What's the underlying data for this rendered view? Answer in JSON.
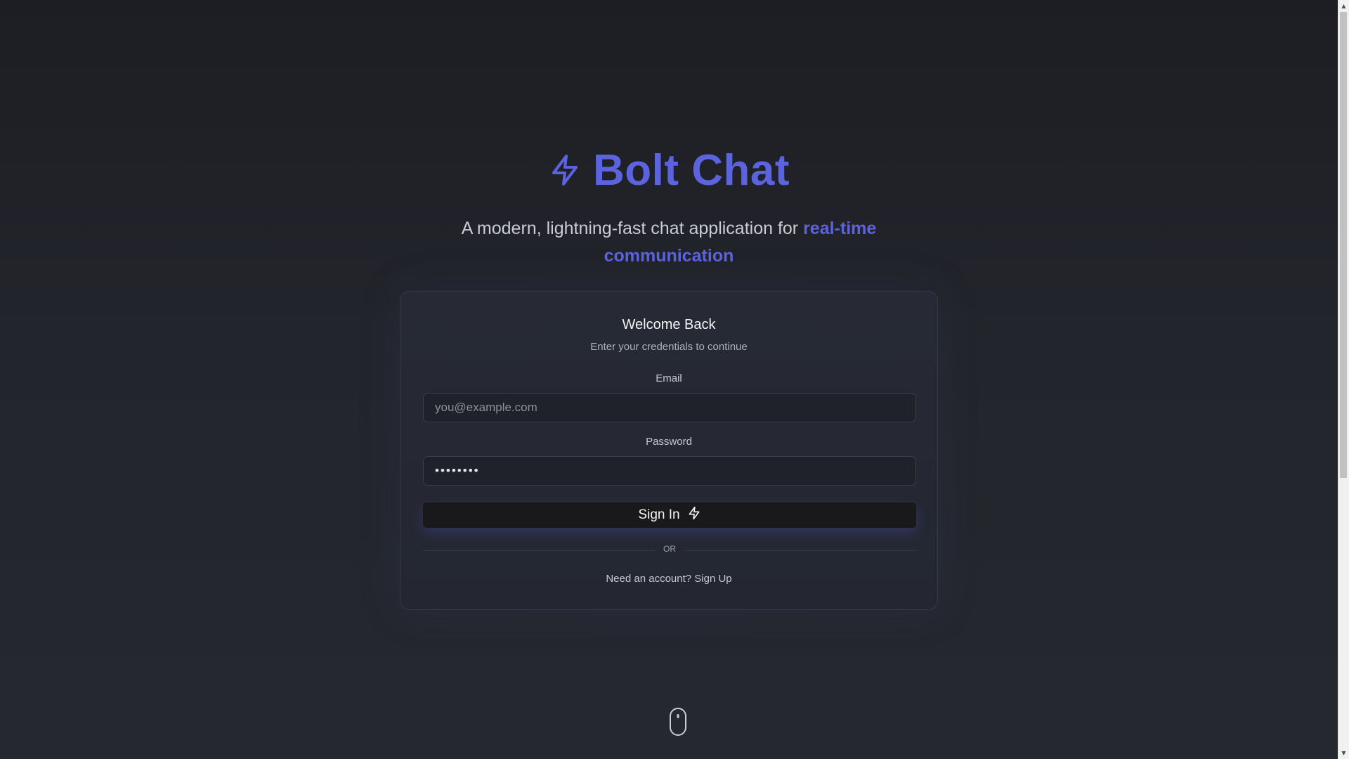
{
  "brand": {
    "title": "Bolt Chat",
    "icon": "lightning-bolt-icon",
    "color": "#5b63de"
  },
  "hero": {
    "tagline_prefix": "A modern, lightning-fast chat application for ",
    "tagline_accent": "real-time communication"
  },
  "login": {
    "title": "Welcome Back",
    "subtitle": "Enter your credentials to continue",
    "email_label": "Email",
    "email_placeholder": "you@example.com",
    "email_value": "",
    "password_label": "Password",
    "password_value": "••••••••",
    "submit_label": "Sign In",
    "submit_icon": "lightning-bolt-icon",
    "divider_text": "OR",
    "signup_text": "Need an account? Sign Up"
  },
  "scroll_hint": {
    "icon": "mouse-scroll-icon"
  }
}
